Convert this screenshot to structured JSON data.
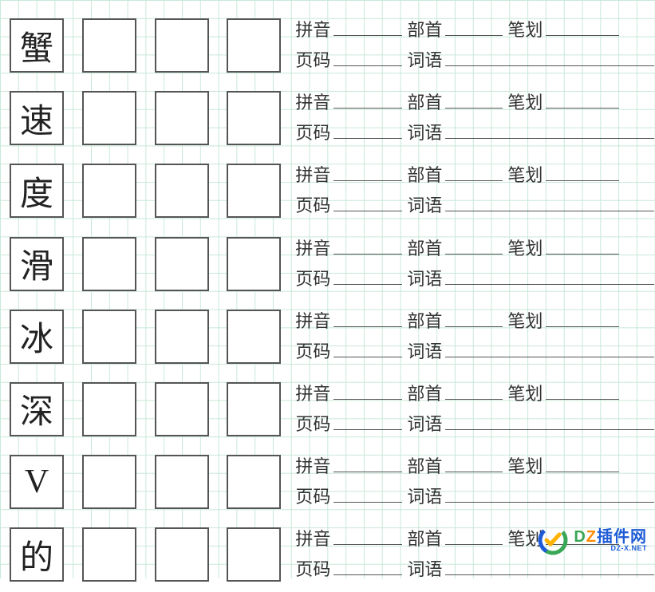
{
  "labels": {
    "pinyin": "拼音",
    "radical": "部首",
    "strokes": "笔划",
    "page": "页码",
    "word": "词语"
  },
  "rows": [
    {
      "char": "蟹"
    },
    {
      "char": "速"
    },
    {
      "char": "度"
    },
    {
      "char": "滑"
    },
    {
      "char": "冰"
    },
    {
      "char": "深"
    },
    {
      "char": "V"
    },
    {
      "char": "的"
    }
  ],
  "practice_boxes_per_row": 3,
  "watermark": {
    "brand_cn": "DZ插件网",
    "brand_url": "DZ-X.NET"
  }
}
